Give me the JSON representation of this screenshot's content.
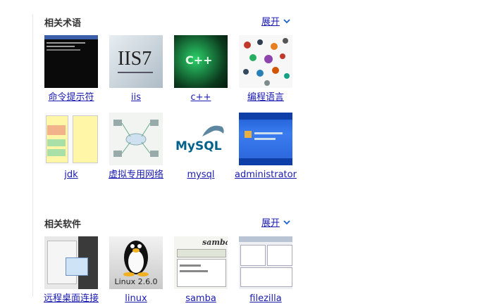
{
  "sections": [
    {
      "title": "相关术语",
      "expand_label": "展开",
      "items": [
        {
          "label": "命令提示符",
          "icon": "cmd-window-thumb"
        },
        {
          "label": "iis",
          "icon": "iis7-thumb",
          "thumb_text": "IIS7"
        },
        {
          "label": "c++",
          "icon": "cpp-thumb",
          "thumb_text": "C++"
        },
        {
          "label": "编程语言",
          "icon": "language-logos-thumb"
        },
        {
          "label": "jdk",
          "icon": "jdk-diagram-thumb"
        },
        {
          "label": "虚拟专用网络",
          "icon": "vpn-diagram-thumb"
        },
        {
          "label": "mysql",
          "icon": "mysql-logo-thumb",
          "thumb_text": "MySQL"
        },
        {
          "label": "administrator",
          "icon": "windows-login-thumb"
        }
      ]
    },
    {
      "title": "相关软件",
      "expand_label": "展开",
      "items": [
        {
          "label": "远程桌面连接",
          "icon": "remote-desktop-thumb"
        },
        {
          "label": "linux",
          "icon": "linux-tux-thumb",
          "thumb_text": "Linux 2.6.0"
        },
        {
          "label": "samba",
          "icon": "samba-thumb",
          "thumb_text": "samba"
        },
        {
          "label": "filezilla",
          "icon": "filezilla-thumb"
        }
      ]
    }
  ],
  "colors": {
    "link": "#1a1ab0",
    "title": "#333333",
    "divider": "#e6e6e6"
  }
}
